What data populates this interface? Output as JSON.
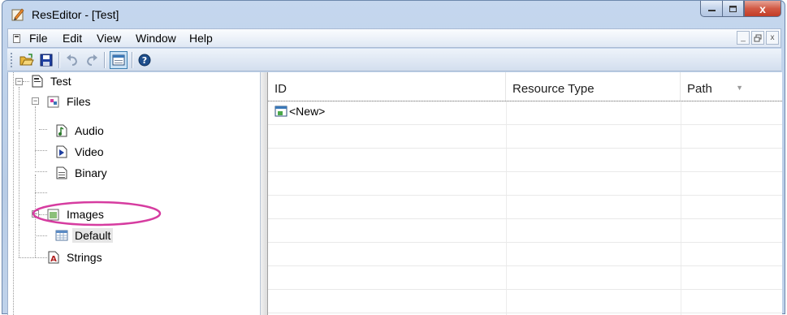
{
  "window": {
    "title": "ResEditor - [Test]"
  },
  "caption_buttons": {
    "minimize": "—",
    "maximize": "□",
    "close": "x"
  },
  "menu": {
    "items": [
      "File",
      "Edit",
      "View",
      "Window",
      "Help"
    ]
  },
  "mdi_buttons": {
    "minimize": "_",
    "restore": "▫",
    "close": "x"
  },
  "toolbar": {
    "buttons": [
      "open-icon",
      "save-icon",
      "undo-icon",
      "redo-icon",
      "view-toggle-icon",
      "help-icon"
    ]
  },
  "tree": {
    "root": "Test",
    "files": "Files",
    "audio": "Audio",
    "video": "Video",
    "binary": "Binary",
    "images": "Images",
    "default": "Default",
    "strings": "Strings"
  },
  "list": {
    "columns": [
      "ID",
      "Resource Type",
      "Path"
    ],
    "rows": [
      {
        "id": "<New>",
        "type": "",
        "path": ""
      }
    ]
  },
  "colors": {
    "title_gradient": "#c5d7ee",
    "close_red": "#c23c26",
    "highlight_ellipse": "#d63ca0"
  }
}
